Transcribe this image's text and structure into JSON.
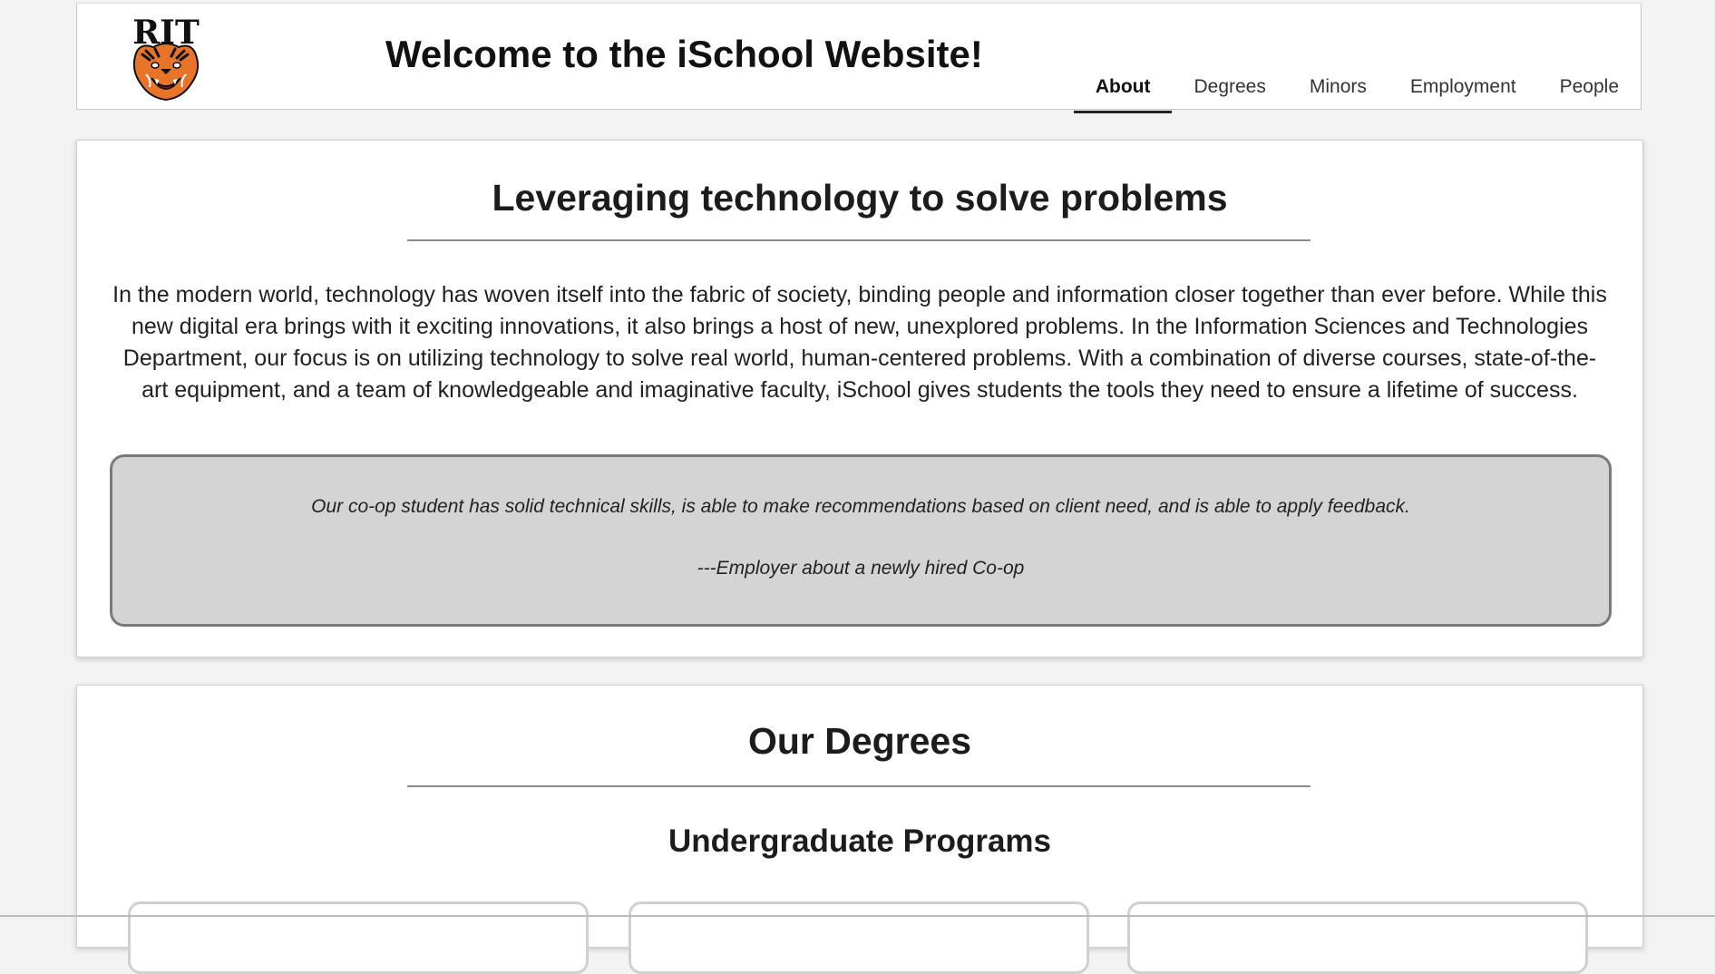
{
  "header": {
    "logo_text": "RIT",
    "title": "Welcome to the iSchool Website!",
    "nav": [
      {
        "label": "About",
        "active": true
      },
      {
        "label": "Degrees",
        "active": false
      },
      {
        "label": "Minors",
        "active": false
      },
      {
        "label": "Employment",
        "active": false
      },
      {
        "label": "People",
        "active": false
      }
    ]
  },
  "about": {
    "title": "Leveraging technology to solve problems",
    "description": "In the modern world, technology has woven itself into the fabric of society, binding people and information closer together than ever before. While this new digital era brings with it exciting innovations, it also brings a host of new, unexplored problems. In the Information Sciences and Technologies Department, our focus is on utilizing technology to solve real world, human-centered problems. With a combination of diverse courses, state-of-the-art equipment, and a team of knowledgeable and imaginative faculty, iSchool gives students the tools they need to ensure a lifetime of success.",
    "quote": "Our co-op student has solid technical skills, is able to make recommendations based on client need, and is able to apply feedback.",
    "quote_author": "---Employer about a newly hired Co-op"
  },
  "degrees": {
    "title": "Our Degrees",
    "undergraduate_title": "Undergraduate Programs"
  },
  "colors": {
    "background": "#f3f3f3",
    "card": "#ffffff",
    "quote_box": "#d4d4d4",
    "tiger_orange": "#e8742a"
  }
}
